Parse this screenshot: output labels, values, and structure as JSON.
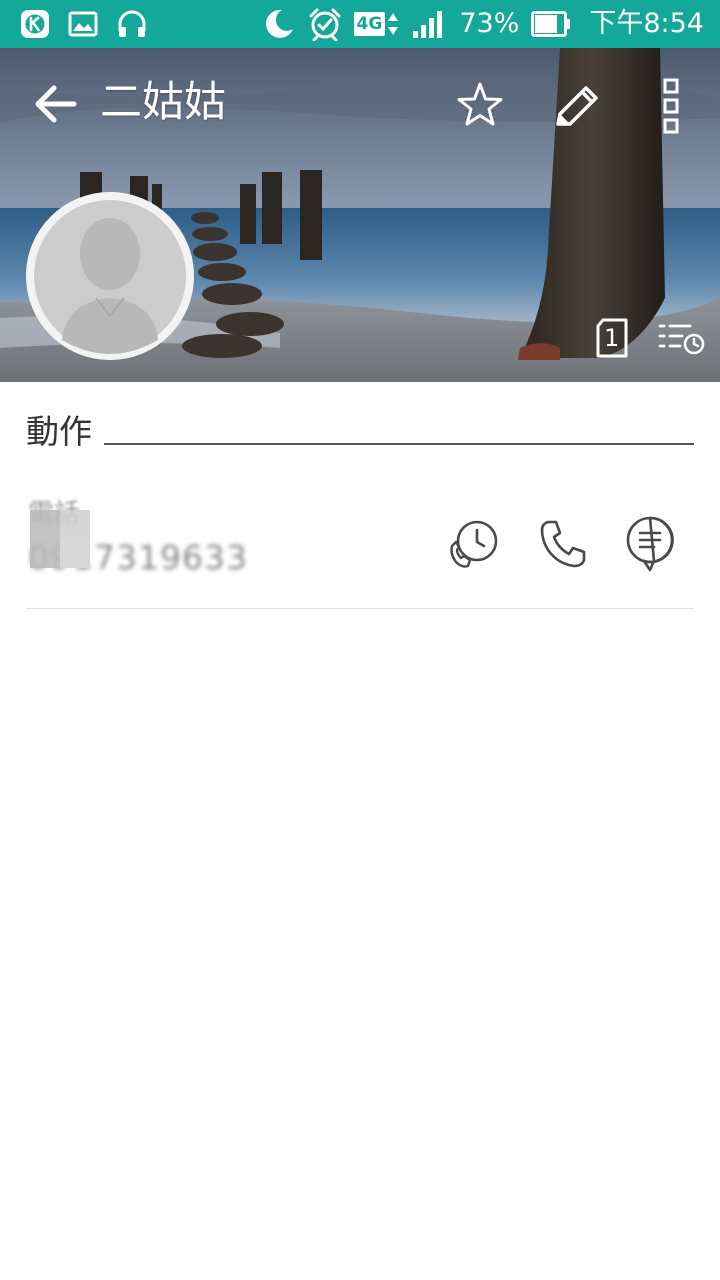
{
  "status_bar": {
    "network": "4G",
    "battery": "73%",
    "time": "下午8:54",
    "left_icons": [
      "k-app-icon",
      "gallery-icon",
      "headphones-icon"
    ],
    "right_icons": [
      "do-not-disturb-moon-icon",
      "alarm-icon",
      "4g-icon",
      "signal-icon",
      "battery-icon"
    ]
  },
  "header": {
    "contact_name": "二姑姑",
    "sim_slot": "1"
  },
  "actions": {
    "title": "動作",
    "phone": {
      "label": "電話",
      "number": "0917319633"
    }
  }
}
